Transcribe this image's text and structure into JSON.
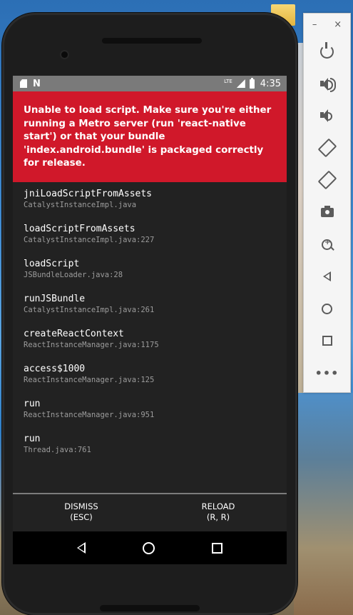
{
  "status_bar": {
    "time": "4:35",
    "network": "LTE"
  },
  "error": {
    "message": "Unable to load script. Make sure you're either running a Metro server (run 'react-native start') or that your bundle 'index.android.bundle' is packaged correctly for release."
  },
  "stack_trace": [
    {
      "method": "jniLoadScriptFromAssets",
      "file": "CatalystInstanceImpl.java"
    },
    {
      "method": "loadScriptFromAssets",
      "file": "CatalystInstanceImpl.java:227"
    },
    {
      "method": "loadScript",
      "file": "JSBundleLoader.java:28"
    },
    {
      "method": "runJSBundle",
      "file": "CatalystInstanceImpl.java:261"
    },
    {
      "method": "createReactContext",
      "file": "ReactInstanceManager.java:1175"
    },
    {
      "method": "access$1000",
      "file": "ReactInstanceManager.java:125"
    },
    {
      "method": "run",
      "file": "ReactInstanceManager.java:951"
    },
    {
      "method": "run",
      "file": "Thread.java:761"
    }
  ],
  "buttons": {
    "dismiss_line1": "DISMISS",
    "dismiss_line2": "(ESC)",
    "reload_line1": "RELOAD",
    "reload_line2": "(R, R)"
  },
  "toolbar": {
    "minimize": "–",
    "close": "×",
    "more": "•••"
  },
  "colors": {
    "error_red": "#d0182a",
    "screen_bg": "#222222",
    "status_bar": "#7a7a7a"
  }
}
